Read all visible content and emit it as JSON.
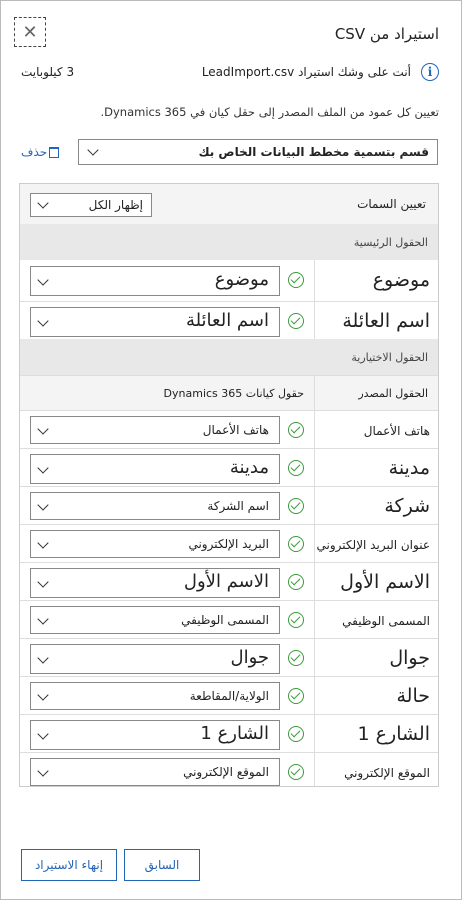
{
  "dialog": {
    "title": "استيراد من CSV",
    "close_icon": "close-icon",
    "info_text": "أنت على وشك استيراد LeadImport.csv",
    "file_size": "3 كيلوبايت",
    "description": "تعيين كل عمود من الملف المصدر إلى حقل كيان في Dynamics 365.",
    "delete_label": "حذف",
    "map_select": "قسم بتسمية مخطط البيانات الخاص بك"
  },
  "panel": {
    "attributes_label": "تعيين السمات",
    "show_all": "إظهار الكل",
    "primary_header": "الحقول الرئيسية",
    "optional_header": "الحقول الاختيارية",
    "col_source": "الحقول المصدر",
    "col_target": "حقول كيانات Dynamics 365",
    "primary_rows": [
      {
        "source": "موضوع",
        "target": "موضوع"
      },
      {
        "source": "اسم العائلة",
        "target": "اسم العائلة"
      }
    ],
    "optional_rows": [
      {
        "source": "هاتف الأعمال",
        "target": "هاتف الأعمال"
      },
      {
        "source": "مدينة",
        "target": "مدينة"
      },
      {
        "source": "شركة",
        "target": "اسم الشركة"
      },
      {
        "source": "عنوان البريد الإلكتروني",
        "target": "البريد الإلكتروني"
      },
      {
        "source": "الاسم الأول",
        "target": "الاسم الأول"
      },
      {
        "source": "المسمى الوظيفي",
        "target": "المسمى الوظيفي"
      },
      {
        "source": "جوال",
        "target": "جوال"
      },
      {
        "source": "حالة",
        "target": "الولاية/المقاطعة"
      },
      {
        "source": "الشارع 1",
        "target": "الشارع 1"
      },
      {
        "source": "الموقع الإلكتروني",
        "target": "الموقع الإلكتروني"
      }
    ]
  },
  "footer": {
    "finish_label": "إنهاء الاستيراد",
    "prev_label": "السابق"
  }
}
